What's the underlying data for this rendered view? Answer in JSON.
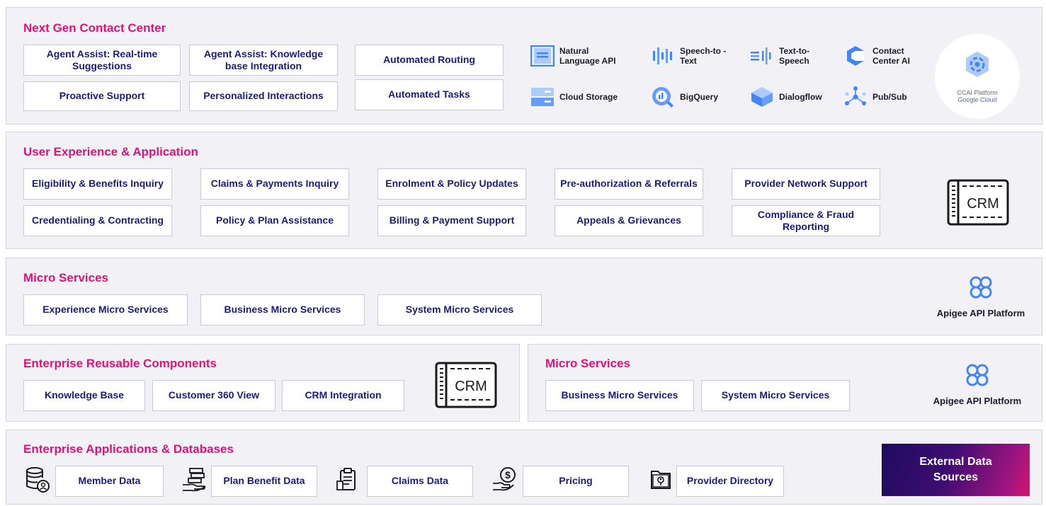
{
  "contact_center": {
    "title": "Next Gen Contact Center",
    "features": [
      "Agent Assist: Real-time Suggestions",
      "Agent Assist: Knowledge base Integration",
      "Automated Routing",
      "Proactive Support",
      "Personalized Interactions",
      "Automated Tasks"
    ],
    "products": [
      {
        "name": "Natural Language API",
        "icon": "natural-language-icon"
      },
      {
        "name": "Speech-to -Text",
        "icon": "speech-to-text-icon"
      },
      {
        "name": "Text-to-Speech",
        "icon": "text-to-speech-icon"
      },
      {
        "name": "Contact Center AI",
        "icon": "contact-center-ai-icon"
      },
      {
        "name": "Cloud Storage",
        "icon": "cloud-storage-icon"
      },
      {
        "name": "BigQuery",
        "icon": "bigquery-icon"
      },
      {
        "name": "Dialogflow",
        "icon": "dialogflow-icon"
      },
      {
        "name": "Pub/Sub",
        "icon": "pubsub-icon"
      }
    ],
    "ccai_badge": {
      "line1": "CCAI Platform",
      "line2": "Google Cloud"
    }
  },
  "user_experience": {
    "title": "User Experience & Application",
    "features": [
      "Eligibility & Benefits Inquiry",
      "Claims & Payments Inquiry",
      "Enrolment & Policy Updates",
      "Pre-authorization & Referrals",
      "Provider Network Support",
      "Credentialing & Contracting",
      "Policy & Plan Assistance",
      "Billing & Payment Support",
      "Appeals & Grievances",
      "Compliance & Fraud Reporting"
    ],
    "crm_label": "CRM"
  },
  "micro_services_top": {
    "title": "Micro Services",
    "items": [
      "Experience Micro Services",
      "Business Micro Services",
      "System Micro Services"
    ],
    "platform": "Apigee API Platform"
  },
  "reusable_components": {
    "title": "Enterprise Reusable Components",
    "items": [
      "Knowledge Base",
      "Customer 360 View",
      "CRM Integration"
    ],
    "crm_label": "CRM"
  },
  "micro_services_bottom": {
    "title": "Micro Services",
    "items": [
      "Business Micro Services",
      "System Micro Services"
    ],
    "platform": "Apigee API Platform"
  },
  "enterprise_apps": {
    "title": "Enterprise Applications & Databases",
    "items": [
      {
        "label": "Member Data",
        "icon": "member-database-icon"
      },
      {
        "label": "Plan Benefit Data",
        "icon": "money-hand-icon"
      },
      {
        "label": "Claims Data",
        "icon": "claims-clipboard-icon"
      },
      {
        "label": "Pricing",
        "icon": "pricing-dollar-icon"
      },
      {
        "label": "Provider Directory",
        "icon": "provider-directory-icon"
      }
    ],
    "external": "External Data Sources"
  },
  "colors": {
    "title": "#e0117a",
    "box_text": "#1c1c78",
    "panel_bg": "#f2f2f6",
    "gradient_start": "#1e0c5e",
    "gradient_end": "#d8126f",
    "google_blue": "#4285f4"
  }
}
